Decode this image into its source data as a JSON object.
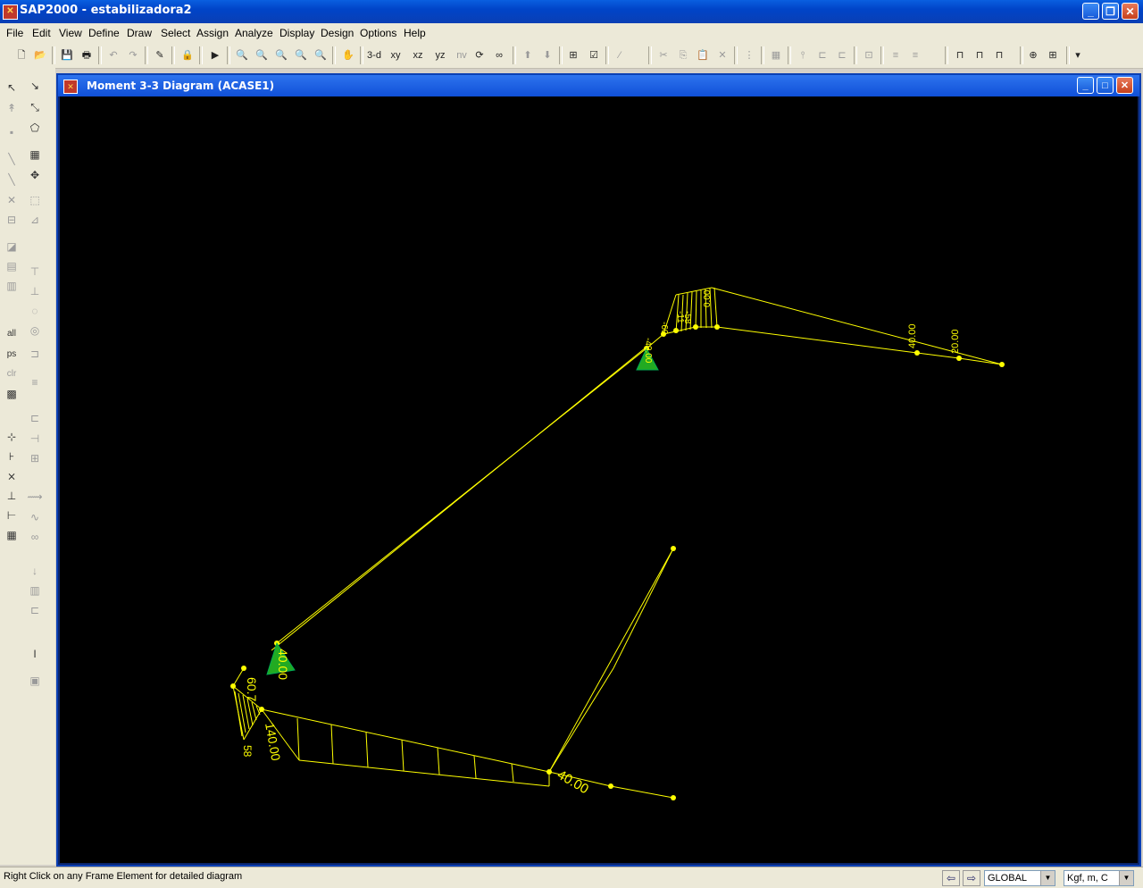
{
  "app": {
    "title": "SAP2000 - estabilizadora2"
  },
  "menu": [
    "File",
    "Edit",
    "View",
    "Define",
    "Draw",
    "Select",
    "Assign",
    "Analyze",
    "Display",
    "Design",
    "Options",
    "Help"
  ],
  "toolbar": {
    "view_3d": "3-d",
    "view_xy": "xy",
    "view_xz": "xz",
    "view_yz": "yz",
    "view_nv": "nv"
  },
  "lefttools": {
    "all": "all",
    "ps": "ps",
    "clr": "clr"
  },
  "child_window": {
    "title": "Moment 3-3 Diagram   (ACASE1)"
  },
  "diagram": {
    "line_color": "#ffff00",
    "support_color": "#22aa22",
    "labels": [
      "-58",
      "-11",
      "-60",
      "-40.00",
      "0.00",
      "40.00",
      "20.00",
      "40.00",
      "60.7",
      "140.00",
      "40.00",
      "58"
    ]
  },
  "status": {
    "message": "Right Click on any Frame Element for detailed diagram",
    "coord_system": "GLOBAL",
    "units": "Kgf, m, C"
  }
}
